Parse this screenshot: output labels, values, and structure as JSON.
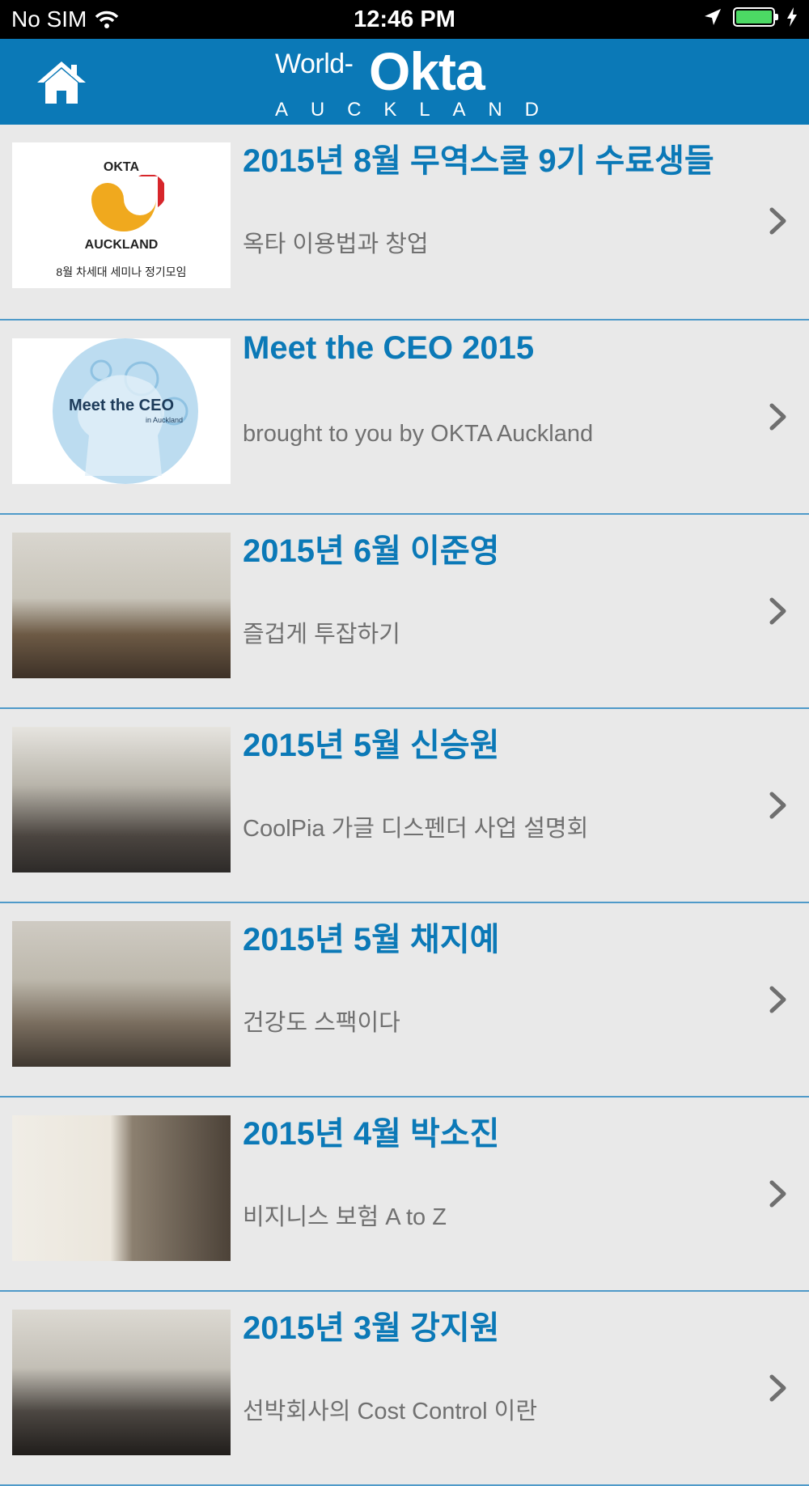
{
  "status_bar": {
    "carrier": "No SIM",
    "time": "12:46 PM",
    "icons": [
      "wifi-icon",
      "location-arrow-icon",
      "battery-icon",
      "charging-bolt-icon"
    ],
    "battery_color": "#4cd964"
  },
  "header": {
    "background": "#0b79b7",
    "home_icon": "home-icon",
    "logo": {
      "prefix": "World-",
      "brand": "Okta",
      "city": "AUCKLAND"
    }
  },
  "items": [
    {
      "title": "2015년 8월 무역스쿨 9기 수료생들",
      "subtitle": "옥타 이용법과 창업",
      "thumb": {
        "kind": "okta-poster",
        "brand": "OKTA",
        "city": "AUCKLAND",
        "caption": "8월 차세대 세미나 정기모임"
      }
    },
    {
      "title": "Meet the CEO 2015",
      "subtitle": "brought to you by OKTA Auckland",
      "thumb": {
        "kind": "ceo-graphic",
        "headline": "Meet the CEO",
        "caption": "in Auckland"
      }
    },
    {
      "title": "2015년 6월 이준영",
      "subtitle": "즐겁게 투잡하기",
      "thumb": {
        "kind": "photo"
      }
    },
    {
      "title": "2015년 5월 신승원",
      "subtitle": "CoolPia 가글 디스펜더 사업 설명회",
      "thumb": {
        "kind": "photo"
      }
    },
    {
      "title": "2015년 5월 채지예",
      "subtitle": "건강도 스팩이다",
      "thumb": {
        "kind": "photo"
      }
    },
    {
      "title": "2015년 4월 박소진",
      "subtitle": "비지니스 보험 A to Z",
      "thumb": {
        "kind": "photo"
      }
    },
    {
      "title": "2015년 3월 강지원",
      "subtitle": "선박회사의 Cost Control 이란",
      "thumb": {
        "kind": "photo"
      }
    }
  ],
  "colors": {
    "title": "#0b79b7",
    "subtitle": "#707070",
    "divider": "#4f9ac9",
    "background": "#e9e9e9"
  }
}
